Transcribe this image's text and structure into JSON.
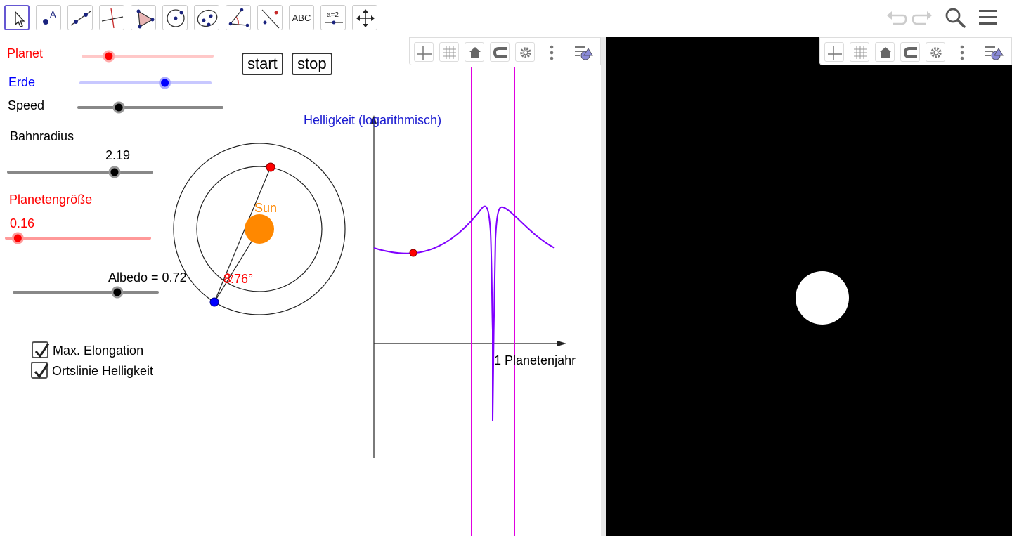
{
  "toolbar": {
    "tools": [
      {
        "name": "move-tool",
        "icon": "pointer-icon",
        "active": true
      },
      {
        "name": "point-tool",
        "icon": "point-icon",
        "label": "A"
      },
      {
        "name": "line-tool",
        "icon": "line-icon"
      },
      {
        "name": "perpendicular-tool",
        "icon": "perpendicular-line-icon"
      },
      {
        "name": "polygon-tool",
        "icon": "polygon-icon"
      },
      {
        "name": "circle-tool",
        "icon": "circle-icon"
      },
      {
        "name": "ellipse-tool",
        "icon": "ellipse-icon"
      },
      {
        "name": "angle-tool",
        "icon": "angle-icon"
      },
      {
        "name": "reflect-tool",
        "icon": "reflect-icon"
      },
      {
        "name": "text-tool",
        "icon": "text-icon",
        "label": "ABC"
      },
      {
        "name": "slider-tool",
        "icon": "slider-icon",
        "label": "a = 2"
      },
      {
        "name": "move-view-tool",
        "icon": "move-arrows-icon"
      }
    ],
    "right_icons": [
      "undo-icon",
      "redo-icon",
      "search-icon",
      "menu-icon"
    ]
  },
  "stylebar_icons": [
    "axes-icon",
    "grid-icon",
    "home-icon",
    "magnet-icon",
    "gear-icon",
    "more-icon",
    "view-menu-icon"
  ],
  "sliders": {
    "planet": {
      "label": "Planet",
      "color": "#ff0000",
      "track": "#ffc8c8",
      "value": 0.2
    },
    "erde": {
      "label": "Erde",
      "color": "#0000ff",
      "track": "#c8c8ff",
      "value": 0.65
    },
    "speed": {
      "label": "Speed",
      "value": 0.28
    },
    "bahnradius": {
      "label": "Bahnradius",
      "value_text": "2.19",
      "value": 0.74
    },
    "planetengroesse": {
      "label": "Planetengröße",
      "value_text": "0.16",
      "value": 0.08,
      "color": "#ff0000"
    },
    "albedo": {
      "label": "Albedo = 0.72",
      "value": 0.72
    }
  },
  "buttons": {
    "start": "start",
    "stop": "stop"
  },
  "checkboxes": [
    {
      "label": "Max. Elongation",
      "checked": true
    },
    {
      "label": "Ortslinie Helligkeit",
      "checked": true
    }
  ],
  "orbit": {
    "sun_label": "Sun",
    "angle_label": "8.76°",
    "sun_color": "#ff8800",
    "planet_color": "#ff0000",
    "earth_color": "#0000ff"
  },
  "graph": {
    "ylabel": "Helligkeit (logarithmisch)",
    "xlabel": "1 Planetenjahr",
    "curve_color": "#8000ff",
    "line_color": "#e000e0",
    "ylabel_color": "#1a1ad0"
  }
}
